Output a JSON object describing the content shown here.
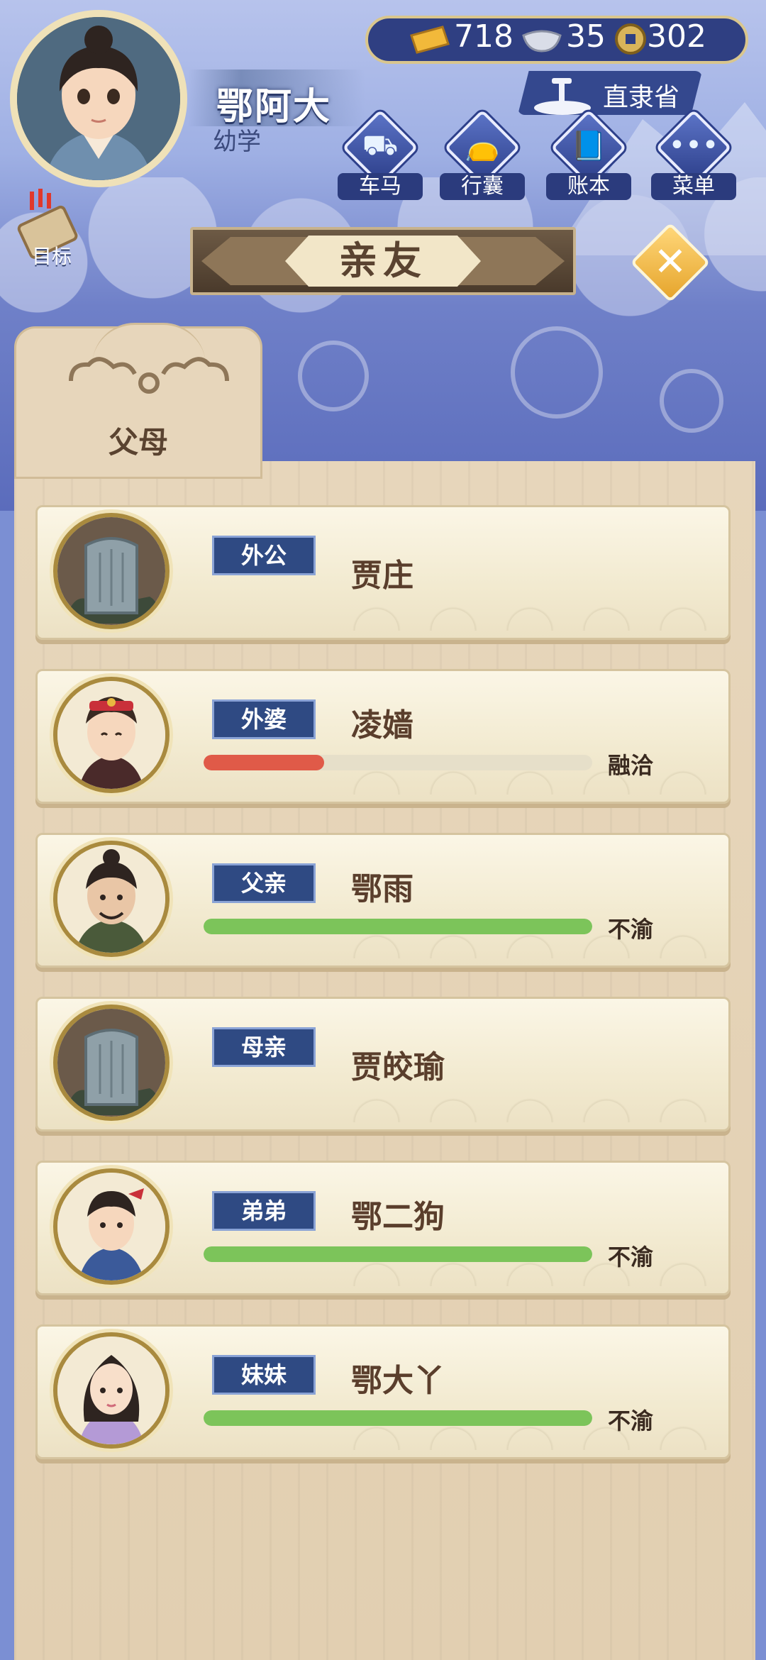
{
  "player": {
    "name": "鄂阿大",
    "rank": "幼学",
    "goal_label": "目标"
  },
  "currency": {
    "gold": "718",
    "silver": "35",
    "coin": "302"
  },
  "location": "直隶省",
  "menu": [
    {
      "label": "车马",
      "icon": "carriage-icon"
    },
    {
      "label": "行囊",
      "icon": "bag-icon"
    },
    {
      "label": "账本",
      "icon": "ledger-icon"
    },
    {
      "label": "菜单",
      "icon": "more-icon"
    }
  ],
  "title": "亲友",
  "tab": "父母",
  "relatives": [
    {
      "role": "外公",
      "name": "贾庄",
      "portrait": "tombstone",
      "status": "",
      "bar": null
    },
    {
      "role": "外婆",
      "name": "凌嫱",
      "portrait": "grandma",
      "status": "融洽",
      "bar": 0.31,
      "bar_color": "#e05a48"
    },
    {
      "role": "父亲",
      "name": "鄂雨",
      "portrait": "father",
      "status": "不渝",
      "bar": 1.0,
      "bar_color": "#7cc45a"
    },
    {
      "role": "母亲",
      "name": "贾皎瑜",
      "portrait": "tombstone",
      "status": "",
      "bar": null
    },
    {
      "role": "弟弟",
      "name": "鄂二狗",
      "portrait": "brother",
      "status": "不渝",
      "bar": 1.0,
      "bar_color": "#7cc45a"
    },
    {
      "role": "妹妹",
      "name": "鄂大丫",
      "portrait": "sister",
      "status": "不渝",
      "bar": 1.0,
      "bar_color": "#7cc45a"
    }
  ]
}
